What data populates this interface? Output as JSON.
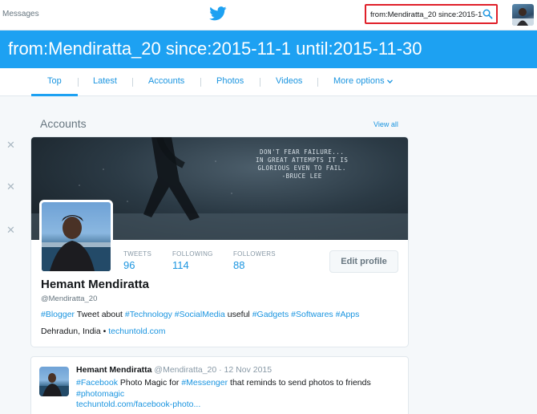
{
  "topbar": {
    "messages_label": "Messages",
    "search_value": "from:Mendiratta_20 since:2015-11-"
  },
  "banner": {
    "query": "from:Mendiratta_20 since:2015-11-1 until:2015-11-30"
  },
  "tabs": [
    {
      "label": "Top",
      "active": true
    },
    {
      "label": "Latest"
    },
    {
      "label": "Accounts"
    },
    {
      "label": "Photos"
    },
    {
      "label": "Videos"
    },
    {
      "label": "More options"
    }
  ],
  "accounts": {
    "heading": "Accounts",
    "view_all": "View all"
  },
  "profile": {
    "header_quote": "DON'T FEAR FAILURE...\nIN GREAT ATTEMPTS IT IS\nGLORIOUS EVEN TO FAIL.\n-BRUCE LEE",
    "stats": [
      {
        "label": "TWEETS",
        "value": "96"
      },
      {
        "label": "FOLLOWING",
        "value": "114"
      },
      {
        "label": "FOLLOWERS",
        "value": "88"
      }
    ],
    "edit_label": "Edit profile",
    "name": "Hemant Mendiratta",
    "handle": "@Mendiratta_20",
    "bio": {
      "tag1": "#Blogger",
      "t1": " Tweet about ",
      "tag2": "#Technology",
      "t2": " ",
      "tag3": "#SocialMedia",
      "t3": " useful ",
      "tag4": "#Gadgets",
      "t4": " ",
      "tag5": "#Softwares",
      "t5": " ",
      "tag6": "#Apps"
    },
    "location": "Dehradun, India",
    "sep": " • ",
    "website": "techuntold.com"
  },
  "tweet": {
    "name": "Hemant Mendiratta",
    "meta": " @Mendiratta_20 · 12 Nov 2015",
    "tag1": "#Facebook",
    "t1": " Photo Magic for ",
    "tag2": "#Messenger",
    "t2": " that reminds to send photos to friends",
    "tag3": "#photomagic",
    "url": "techuntold.com/facebook-photo..."
  },
  "colors": {
    "brand_blue": "#1da1f2",
    "link_blue": "#1b95e0",
    "highlight_red": "#e0202a"
  }
}
